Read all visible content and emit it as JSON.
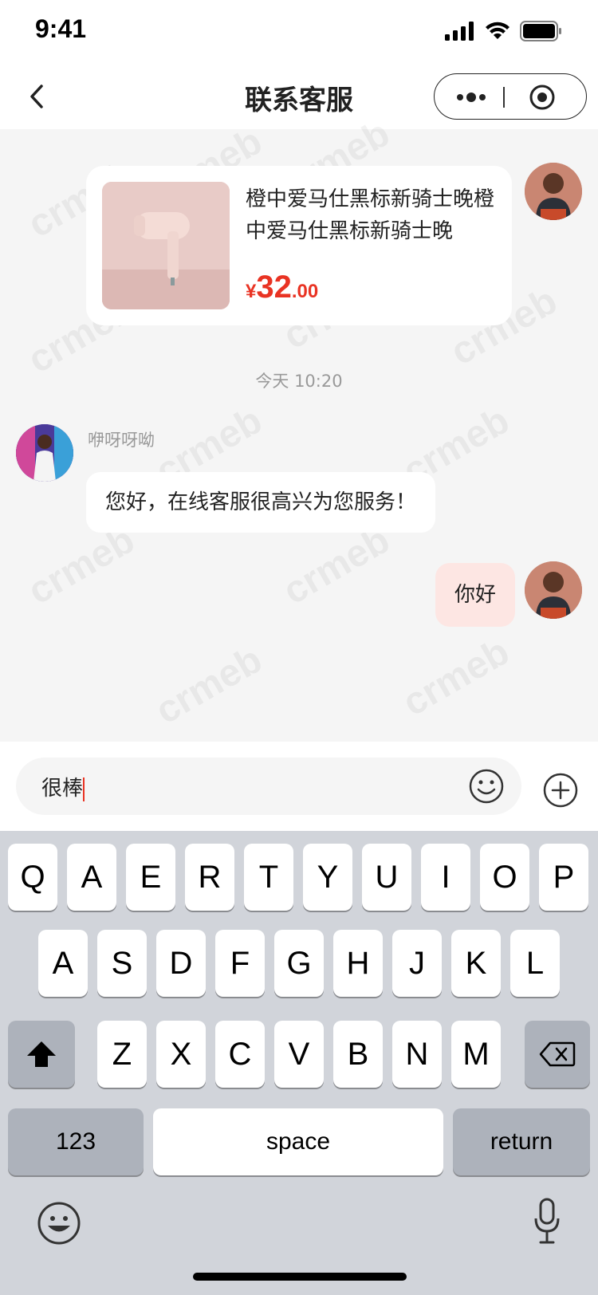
{
  "status_bar": {
    "time": "9:41"
  },
  "nav": {
    "title": "联系客服"
  },
  "product": {
    "title": "橙中爱马仕黑标新骑士晚橙中爱马仕黑标新骑士晚",
    "price_symbol": "¥",
    "price_integer": "32",
    "price_decimal": ".00"
  },
  "chat": {
    "time_divider": "今天 10:20",
    "agent_name": "咿呀呀呦",
    "agent_message": "您好，在线客服很高兴为您服务！",
    "user_message": "你好"
  },
  "input": {
    "value": "很棒"
  },
  "keyboard": {
    "row1": [
      "Q",
      "A",
      "E",
      "R",
      "T",
      "Y",
      "U",
      "I",
      "O",
      "P"
    ],
    "row2": [
      "A",
      "S",
      "D",
      "F",
      "G",
      "H",
      "J",
      "K",
      "L"
    ],
    "row3": [
      "Z",
      "X",
      "C",
      "V",
      "B",
      "N",
      "M"
    ],
    "numbers_key": "123",
    "space_key": "space",
    "return_key": "return"
  },
  "watermark_text": "crmeb",
  "colors": {
    "accent": "#e93323",
    "user_bubble": "#fde6e3"
  }
}
